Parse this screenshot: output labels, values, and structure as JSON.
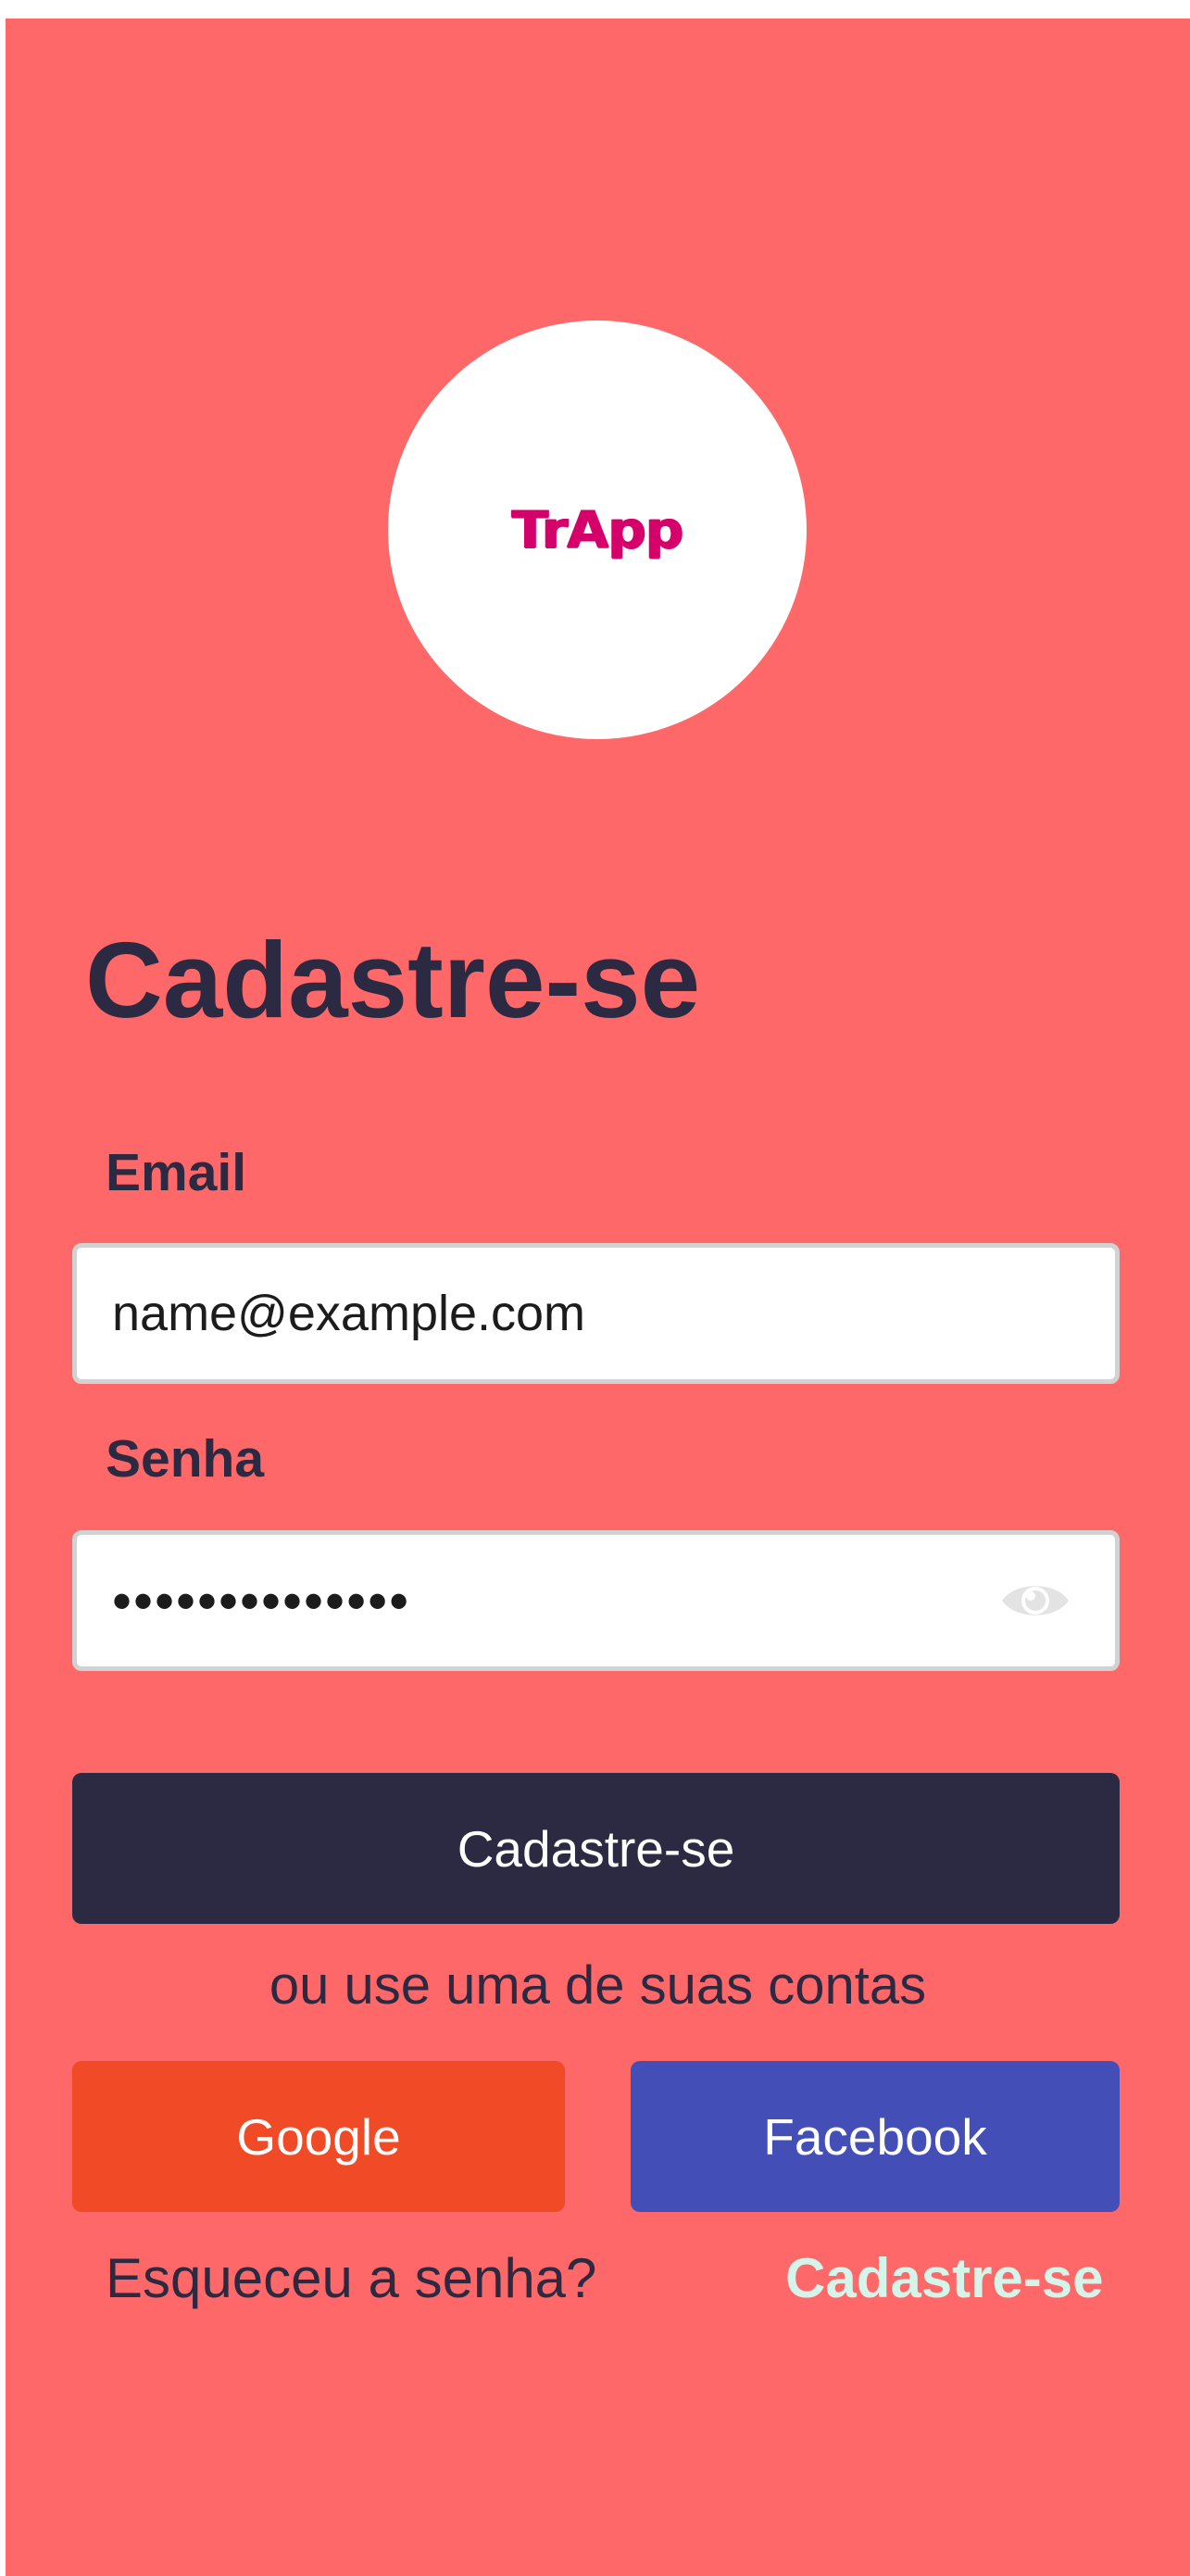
{
  "logo": {
    "text": "TrApp",
    "color": "#d6006b"
  },
  "page": {
    "title": "Cadastre-se",
    "background": "#ff6868"
  },
  "email": {
    "label": "Email",
    "value": "name@example.com"
  },
  "password": {
    "label": "Senha",
    "value": "••••••••••••••",
    "toggle_icon": "eye-icon"
  },
  "actions": {
    "submit_label": "Cadastre-se",
    "divider_text": "ou use uma de suas contas",
    "google_label": "Google",
    "facebook_label": "Facebook",
    "forgot_label": "Esqueceu a senha?",
    "signup_label": "Cadastre-se"
  },
  "colors": {
    "primary": "#2b2a42",
    "google": "#f04a27",
    "facebook": "#434eb6",
    "signup_link": "#d6f5ea"
  }
}
